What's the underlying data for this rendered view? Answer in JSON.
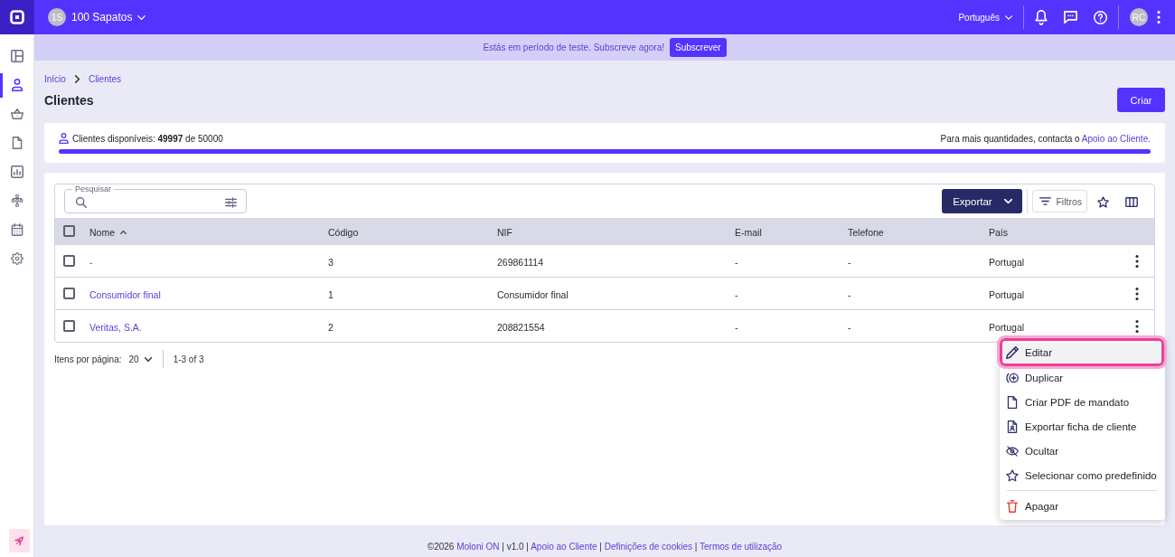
{
  "top_bar": {
    "company_initials": "1S",
    "company_name": "100 Sapatos",
    "language": "Português",
    "user_initials": "RC"
  },
  "sidebar": {
    "items": [
      {
        "selected": false
      },
      {
        "selected": true
      },
      {
        "selected": false
      },
      {
        "selected": false
      },
      {
        "selected": false
      },
      {
        "selected": false
      },
      {
        "selected": false
      },
      {
        "selected": false
      }
    ]
  },
  "trial_banner": {
    "message": "Estás em período de teste. Subscreve agora!",
    "button": "Subscrever"
  },
  "breadcrumb": [
    {
      "label": "Início"
    },
    {
      "label": "Clientes"
    }
  ],
  "page": {
    "title": "Clientes",
    "create_button": "Criar"
  },
  "usage": {
    "label": "Clientes disponíveis: **49997** de 50000",
    "note": "Para mais quantidades, contacta o",
    "note_link": "Apoio ao Cliente.",
    "level": 1
  },
  "table": {
    "search_label": "Pesquisar",
    "export_button": "Exportar",
    "filters_button": "Filtros",
    "select_all_checked": false,
    "columns": [
      {
        "label": "Nome",
        "sorted": true
      },
      {
        "label": "Código",
        "sorted": false
      },
      {
        "label": "NIF",
        "sorted": false
      },
      {
        "label": "E-mail",
        "sorted": false
      },
      {
        "label": "Telefone",
        "sorted": false
      },
      {
        "label": "País",
        "sorted": false
      }
    ],
    "rows": [
      {
        "checked": false,
        "cells": [
          "-",
          "3",
          "269861114",
          "-",
          "-",
          "Portugal"
        ]
      },
      {
        "checked": false,
        "cells": [
          "Consumidor final",
          "1",
          "Consumidor final",
          "-",
          "-",
          "Portugal"
        ]
      },
      {
        "checked": false,
        "cells": [
          "Veritas, S.A.",
          "2",
          "208821554",
          "-",
          "-",
          "Portugal"
        ]
      }
    ]
  },
  "pagination": {
    "label": "Itens por página:",
    "page_size": "20",
    "range": "1-3 of 3"
  },
  "row_menu": {
    "groups": [
      [
        {
          "kind": "action",
          "label": "Editar",
          "highlighted": true
        },
        {
          "kind": "action",
          "label": "Duplicar",
          "highlighted": false
        },
        {
          "kind": "action",
          "label": "Criar PDF de mandato",
          "highlighted": false
        },
        {
          "kind": "action",
          "label": "Exportar ficha de cliente",
          "highlighted": false
        },
        {
          "kind": "action",
          "label": "Ocultar",
          "highlighted": false
        },
        {
          "kind": "action",
          "label": "Selecionar como predefinido",
          "highlighted": false
        }
      ],
      [
        {
          "kind": "danger",
          "label": "Apagar",
          "highlighted": false
        }
      ]
    ]
  },
  "footer": [
    {
      "kind": "text",
      "text": "©2026"
    },
    {
      "kind": "link",
      "text": "Moloni ON"
    },
    {
      "kind": "separator",
      "text": "|"
    },
    {
      "kind": "text",
      "text": "v1.0"
    },
    {
      "kind": "separator",
      "text": "|"
    },
    {
      "kind": "link",
      "text": "Apoio ao Cliente"
    },
    {
      "kind": "separator",
      "text": "|"
    },
    {
      "kind": "link",
      "text": "Definições de cookies"
    },
    {
      "kind": "separator",
      "text": "|"
    },
    {
      "kind": "link",
      "text": "Termos de utilização"
    }
  ]
}
